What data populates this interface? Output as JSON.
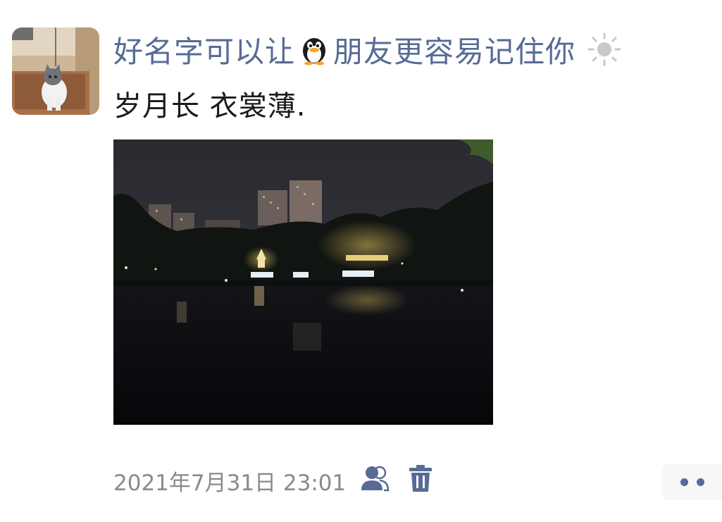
{
  "post": {
    "username_part1": "好名字可以让",
    "username_emoji": "penguin-icon",
    "username_part2": "朋友更容易记住你",
    "username_suffix_icon": "sun-icon",
    "text": "岁月长 衣裳薄.",
    "photo_description_icon": "night-lake-photo",
    "timestamp": "2021年7月31日 23:01",
    "visibility_icon": "friends-visibility-icon",
    "delete_icon": "trash-icon",
    "more_icon": "more-dots-icon"
  },
  "colors": {
    "link": "#576b95",
    "text": "#1a1a1a",
    "meta": "#8a8a8a",
    "more_bg": "#f7f7f7"
  }
}
